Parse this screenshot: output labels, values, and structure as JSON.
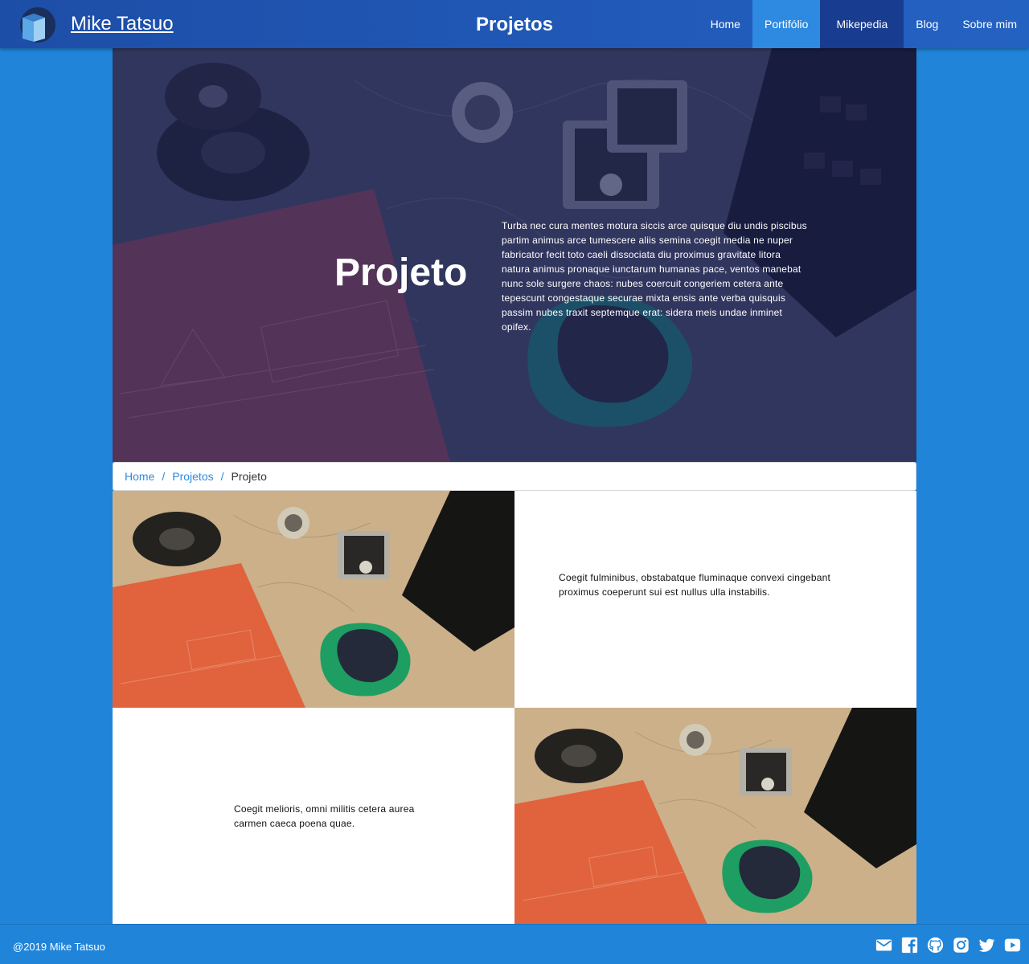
{
  "header": {
    "brand": "Mike Tatsuo",
    "page_heading": "Projetos",
    "nav": [
      {
        "label": "Home"
      },
      {
        "label": "Portifólio"
      },
      {
        "label": "Mikepedia"
      },
      {
        "label": "Blog"
      },
      {
        "label": "Sobre mim"
      }
    ],
    "active_nav": "Portifólio"
  },
  "hero": {
    "title": "Projeto",
    "text": "Turba nec cura mentes motura siccis arce quisque diu undis piscibus partim animus arce tumescere aliis semina coegit media ne nuper fabricator fecit toto caeli dissociata diu proximus gravitate litora natura animus pronaque iunctarum humanas pace, ventos manebat nunc sole surgere chaos: nubes coercuit congeriem cetera ante tepescunt congestaque securae mixta ensis ante verba quisquis passim nubes traxit septemque erat: sidera meis undae inminet opifex."
  },
  "breadcrumb": {
    "items": [
      {
        "label": "Home"
      },
      {
        "label": "Projetos"
      },
      {
        "label": "Projeto"
      }
    ],
    "separator": "/"
  },
  "sections": [
    {
      "text": "Coegit fulminibus, obstabatque fluminaque convexi cingebant proximus coeperunt sui est nullus ulla instabilis."
    },
    {
      "text": "Coegit melioris, omni militis cetera aurea carmen caeca poena quae."
    }
  ],
  "footer": {
    "copyright": "@2019 Mike Tatsuo",
    "social_icons": [
      "mail-icon",
      "facebook-icon",
      "github-icon",
      "instagram-icon",
      "twitter-icon",
      "youtube-icon"
    ]
  },
  "colors": {
    "page_bg": "#2084d9",
    "header_bg": "#1d4ea7",
    "active_nav": "#2d8ae0",
    "dark_nav": "#183c8f",
    "link": "#2d8ae0"
  }
}
